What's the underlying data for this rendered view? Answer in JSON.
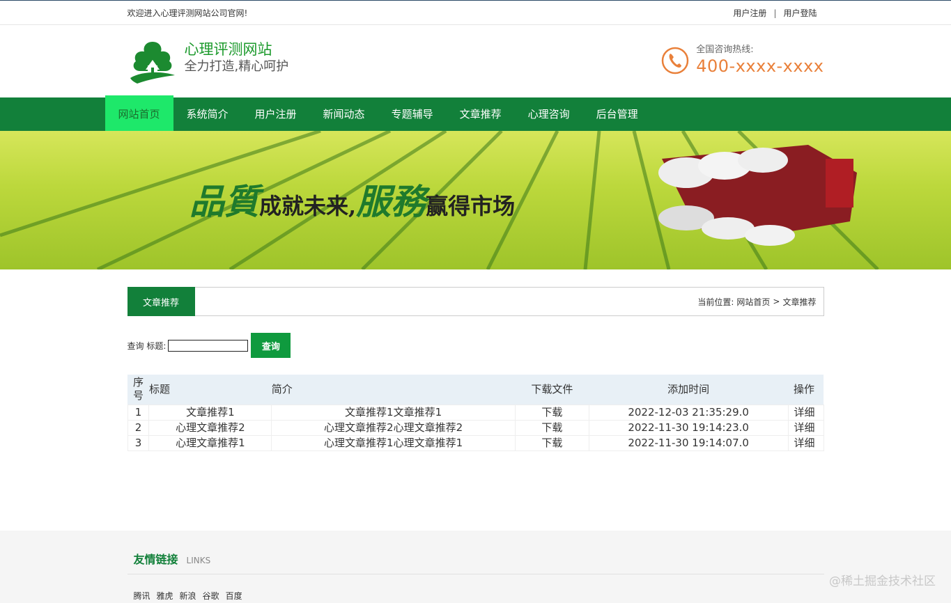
{
  "topbar": {
    "welcome": "欢迎进入心理评测网站公司官网!",
    "register": "用户注册",
    "separator": "|",
    "login": "用户登陆"
  },
  "header": {
    "site_name": "心理评测网站",
    "slogan": "全力打造,精心呵护",
    "hotline_label": "全国咨询热线:",
    "hotline_number": "400-xxxx-xxxx"
  },
  "nav": {
    "items": [
      "网站首页",
      "系统简介",
      "用户注册",
      "新闻动态",
      "专题辅导",
      "文章推荐",
      "心理咨询",
      "后台管理"
    ],
    "active_index": 0
  },
  "banner": {
    "part1_big": "品質",
    "part1": "成就未来,",
    "part2_big": "服務",
    "part2": "赢得市场"
  },
  "section": {
    "tab": "文章推荐",
    "crumb_prefix": "当前位置:",
    "crumb_home": "网站首页",
    "crumb_sep": ">",
    "crumb_current": "文章推荐"
  },
  "search": {
    "label": "查询 标题:",
    "value": "",
    "button": "查询"
  },
  "table": {
    "headers": [
      "序号",
      "标题",
      "简介",
      "下载文件",
      "添加时间",
      "操作"
    ],
    "rows": [
      [
        "1",
        "文章推荐1",
        "文章推荐1文章推荐1",
        "下载",
        "2022-12-03 21:35:29.0",
        "详细"
      ],
      [
        "2",
        "心理文章推荐2",
        "心理文章推荐2心理文章推荐2",
        "下载",
        "2022-11-30 19:14:23.0",
        "详细"
      ],
      [
        "3",
        "心理文章推荐1",
        "心理文章推荐1心理文章推荐1",
        "下载",
        "2022-11-30 19:14:07.0",
        "详细"
      ]
    ]
  },
  "footer": {
    "title": "友情链接",
    "title_en": "LINKS",
    "links": [
      "腾讯",
      "雅虎",
      "新浪",
      "谷歌",
      "百度"
    ],
    "watermark": "@稀土掘金技术社区"
  },
  "colors": {
    "primary_green": "#12803a",
    "active_nav": "#1ee86a",
    "hotline_orange": "#e9803a"
  }
}
